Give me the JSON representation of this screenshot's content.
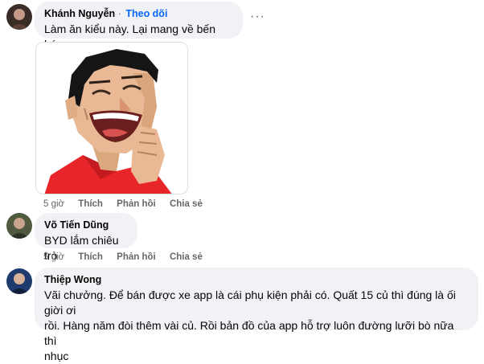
{
  "comments": [
    {
      "author": "Khánh Nguyễn",
      "separator": "·",
      "follow_label": "Theo dõi",
      "text": "Làm ăn kiểu này. Lại mang về bến bán r",
      "more_label": "···",
      "avatar_icon": "user-avatar-icon",
      "sticker_icon": "laughing-man-sticker-icon",
      "actions": {
        "time": "5 giờ",
        "like": "Thích",
        "reply": "Phản hồi",
        "share": "Chia sẻ"
      }
    },
    {
      "author": "Võ Tiến Dũng",
      "text": "BYD lắm chiêu trò",
      "avatar_icon": "user-avatar-icon",
      "actions": {
        "time": "5 giờ",
        "like": "Thích",
        "reply": "Phản hồi",
        "share": "Chia sẻ"
      }
    },
    {
      "author": "Thiệp Wong",
      "text_lines": [
        "Vãi chưởng. Để bán được xe app là cái phụ kiện phải có. Quất 15 củ thì đúng là ối giời ơi",
        "rồi. Hàng năm đòi thêm vài củ. Rồi bản đồ của app hỗ trợ luôn đường lưỡi bò nữa thì",
        "nhục"
      ],
      "avatar_icon": "user-avatar-icon"
    }
  ],
  "colors": {
    "bubble_bg": "#f0f2f5",
    "link_blue": "#0866ff",
    "secondary_text": "#65676b"
  }
}
